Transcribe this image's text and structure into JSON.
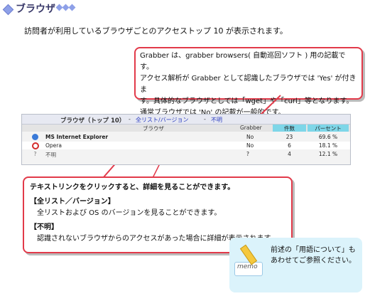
{
  "header": {
    "title": "ブラウザ"
  },
  "intro": "訪問者が利用しているブラウザごとのアクセストップ 10 が表示されます。",
  "callout_grabber": {
    "lines": [
      "Grabber は、grabber browsers( 自動巡回ソフト ) 用の記載です。",
      "アクセス解析が Grabber として認識したブラウザでは 'Yes' が付きま",
      "す。具体的なブラウザとしては「wget」や「curl」等となります。",
      "通常ブラウザでは 'No' の記載が一般的です。"
    ]
  },
  "table": {
    "title": "ブラウザ（トップ 10）",
    "link_sep1": "-",
    "link_all": "全リスト/バージョン",
    "link_sep2": "-",
    "link_unknown": "不明",
    "col_browser": "ブラウザ",
    "col_grabber": "Grabber",
    "col_count": "件数",
    "col_percent": "パーセント",
    "rows": [
      {
        "name": "MS Internet Explorer",
        "grabber": "No",
        "count": "23",
        "percent": "69.6 %",
        "icon": "internet-explorer-icon"
      },
      {
        "name": "Opera",
        "grabber": "No",
        "count": "6",
        "percent": "18.1 %",
        "icon": "opera-icon"
      },
      {
        "name": "不明",
        "grabber": "?",
        "count": "4",
        "percent": "12.1 %",
        "icon": "question-icon"
      }
    ]
  },
  "callout_links": {
    "heading": "テキストリンクをクリックすると、詳細を見ることができます。",
    "all_title": "【全リスト／バージョン】",
    "all_desc": "全リストおよび OS のバージョンを見ることができます。",
    "unknown_title": "【不明】",
    "unknown_desc": "認識されないブラウザからのアクセスがあった場合に詳細が表示されます。"
  },
  "memo": {
    "label": "memo",
    "line1": "前述の「用語について」も",
    "line2": "あわせてご参照ください。"
  },
  "colors": {
    "accent_red": "#e23a4a",
    "header_blue": "#8ea0e8",
    "col_cyan": "#7ed6e8",
    "memo_bg": "#dbf3fb"
  }
}
